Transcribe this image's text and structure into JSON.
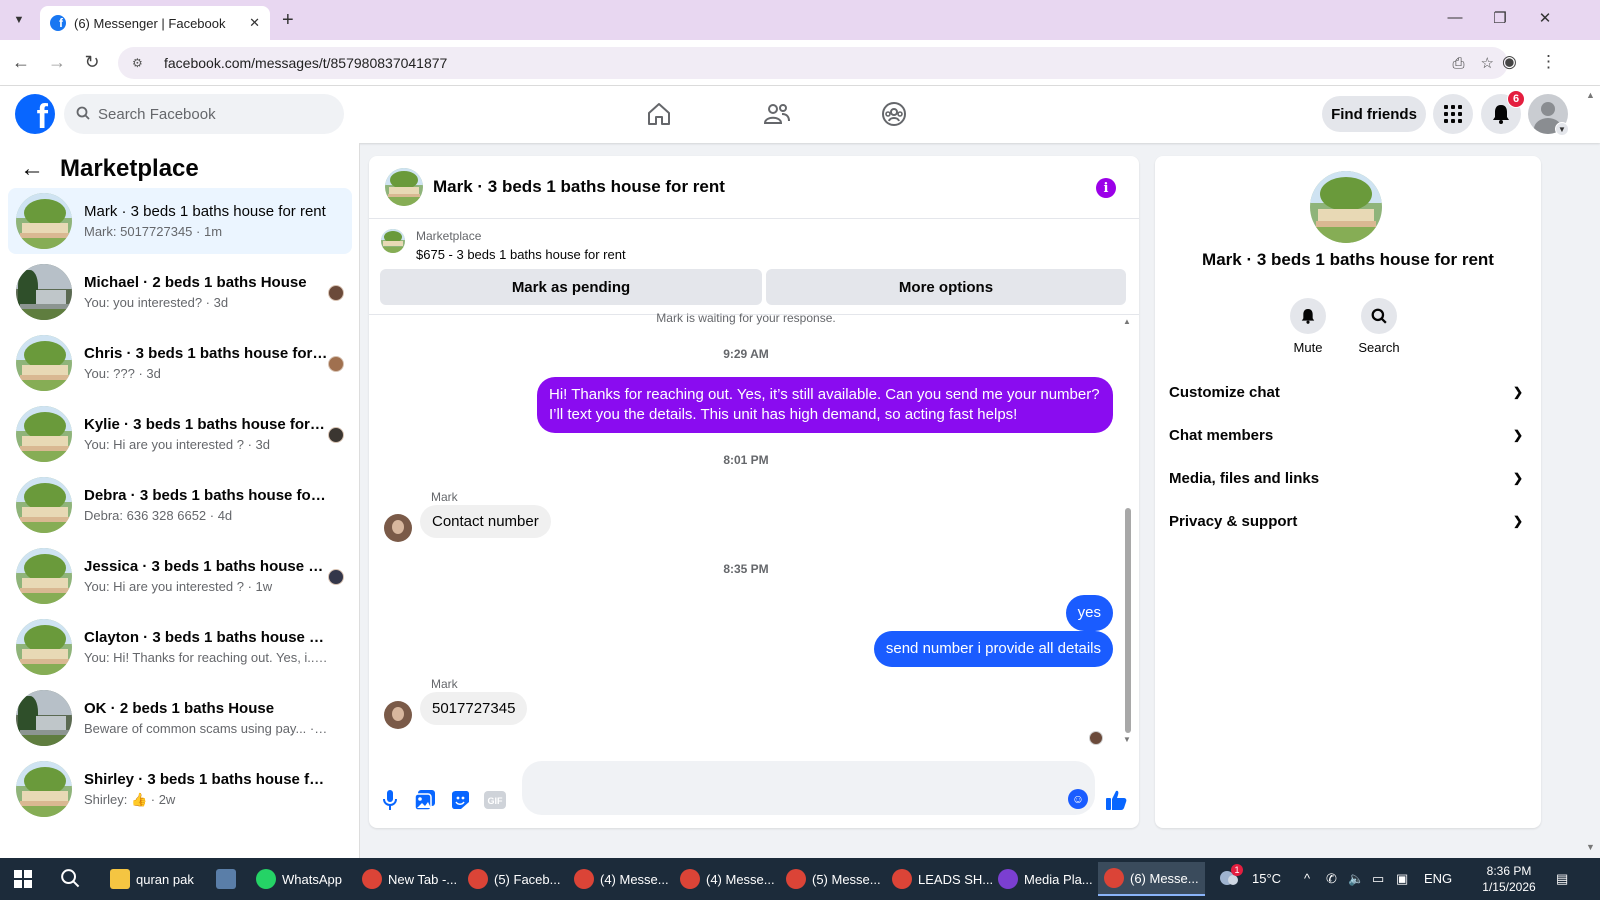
{
  "browser": {
    "tab_title": "(6) Messenger | Facebook",
    "url": "facebook.com/messages/t/857980837041877"
  },
  "header": {
    "search_placeholder": "Search Facebook",
    "find_friends": "Find friends",
    "notification_count": "6"
  },
  "sidebar": {
    "title": "Marketplace",
    "conversations": [
      {
        "name": "Mark · 3 beds 1 baths house for rent",
        "preview": "Mark: 5017727345 · 1m",
        "active": true
      },
      {
        "name": "Michael · 2 beds 1 baths House",
        "preview": "You: you interested? · 3d"
      },
      {
        "name": "Chris · 3 beds 1 baths house for ...",
        "preview": "You: ??? · 3d"
      },
      {
        "name": "Kylie · 3 beds 1 baths house for r...",
        "preview": "You: Hi are you interested ? · 3d"
      },
      {
        "name": "Debra · 3 beds 1 baths house for r...",
        "preview": "Debra: 636 328 6652 · 4d"
      },
      {
        "name": "Jessica · 3 beds 1 baths house fo...",
        "preview": "You: Hi are you interested ? · 1w"
      },
      {
        "name": "Clayton · 3 beds 1 baths house for ...",
        "preview": "You: Hi! Thanks for reaching out. Yes, i... · 1w"
      },
      {
        "name": "OK · 2 beds 1 baths House",
        "preview": "Beware of common scams using pay... · 1w"
      },
      {
        "name": "Shirley · 3 beds 1 baths house for r...",
        "preview": "Shirley: 👍 · 2w"
      }
    ]
  },
  "chat": {
    "title": "Mark · 3 beds 1 baths house for rent",
    "marketplace_label": "Marketplace",
    "listing": "$675 - 3 beds 1 baths house for rent",
    "mark_pending": "Mark as pending",
    "more_options": "More options",
    "waiting_text": "Mark is waiting for your response.",
    "messages": {
      "ts1": "9:29 AM",
      "out1": "Hi! Thanks for reaching out. Yes, it’s still available. Can you send me your number? I’ll text you the details. This unit has high demand, so acting fast helps!",
      "ts2": "8:01 PM",
      "sender1": "Mark",
      "in1": "Contact number",
      "ts3": "8:35 PM",
      "out2": "yes",
      "out3": "send number i provide all details",
      "sender2": "Mark",
      "in2": "5017727345"
    }
  },
  "info_panel": {
    "name": "Mark · 3 beds 1 baths house for rent",
    "mute": "Mute",
    "search": "Search",
    "rows": [
      "Customize chat",
      "Chat members",
      "Media, files and links",
      "Privacy & support"
    ]
  },
  "taskbar": {
    "items": [
      "quran pak",
      "",
      "WhatsApp",
      "New Tab -...",
      "(5) Faceb...",
      "(4) Messe...",
      "(4) Messe...",
      "(5) Messe...",
      "LEADS SH...",
      "Media Pla...",
      "(6) Messe..."
    ],
    "temperature": "15°C",
    "language": "ENG",
    "time": "8:36 PM",
    "date": "1/15/2026",
    "weather_badge": "1"
  },
  "colors": {
    "facebook_blue": "#0866ff",
    "outgoing_purple": "#8a0cf0",
    "outgoing_blue": "#1a5cff",
    "info_purple": "#9b00e8",
    "badge_red": "#e41e3f"
  }
}
